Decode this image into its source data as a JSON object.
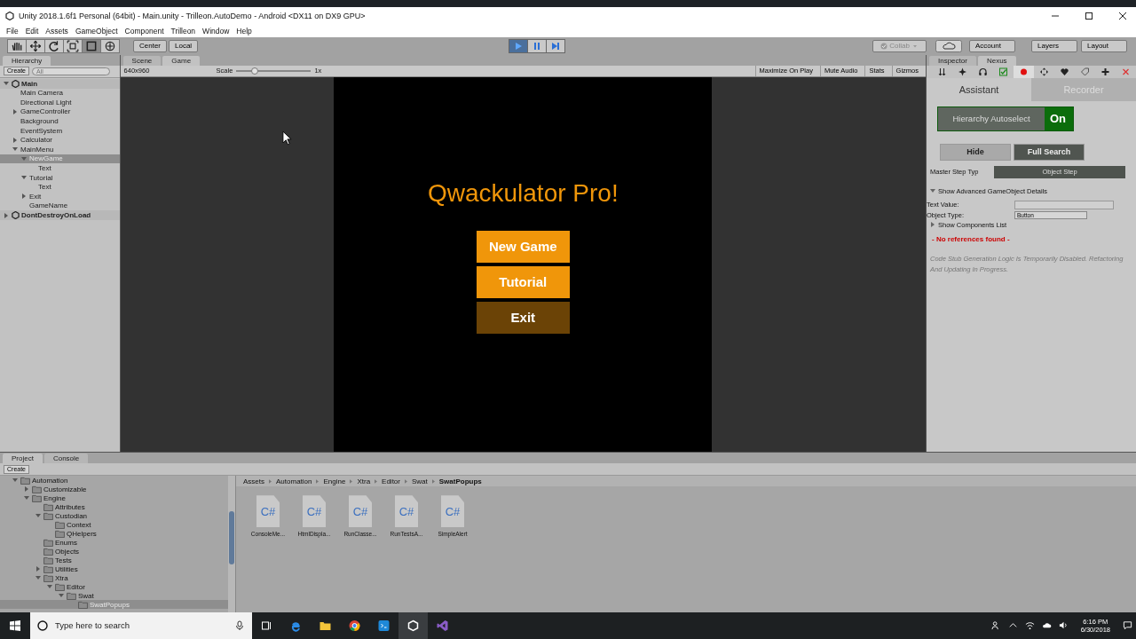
{
  "window": {
    "title": "Unity 2018.1.6f1 Personal (64bit) - Main.unity - Trilleon.AutoDemo - Android <DX11 on DX9 GPU>"
  },
  "menu": [
    "File",
    "Edit",
    "Assets",
    "GameObject",
    "Component",
    "Trilleon",
    "Window",
    "Help"
  ],
  "toolbar": {
    "pivot": "Center",
    "space": "Local",
    "play": [
      {
        "kind": "play",
        "on": true
      },
      {
        "kind": "pause",
        "on": false
      },
      {
        "kind": "step",
        "on": false
      }
    ],
    "collab": "Collab",
    "account": "Account",
    "layers": "Layers",
    "layout": "Layout"
  },
  "hierarchy": {
    "tab": "Hierarchy",
    "create": "Create",
    "search_placeholder": "All",
    "items": [
      {
        "label": "Main",
        "kind": "scene",
        "expanded": true,
        "selected": false,
        "children": [
          {
            "label": "Main Camera",
            "selected": false
          },
          {
            "label": "Directional Light",
            "selected": false
          },
          {
            "label": "GameController",
            "expanded": false,
            "selected": false
          },
          {
            "label": "Background",
            "selected": false
          },
          {
            "label": "EventSystem",
            "selected": false
          },
          {
            "label": "Calculator",
            "expanded": false,
            "selected": false
          },
          {
            "label": "MainMenu",
            "expanded": true,
            "selected": false,
            "children": [
              {
                "label": "NewGame",
                "expanded": true,
                "selected": true,
                "children": [
                  {
                    "label": "Text",
                    "selected": false
                  }
                ]
              },
              {
                "label": "Tutorial",
                "expanded": true,
                "selected": false,
                "children": [
                  {
                    "label": "Text",
                    "selected": false
                  }
                ]
              },
              {
                "label": "Exit",
                "expanded": false,
                "selected": false
              },
              {
                "label": "GameName",
                "selected": false
              }
            ]
          }
        ]
      },
      {
        "label": "DontDestroyOnLoad",
        "kind": "scene",
        "expanded": false,
        "selected": false
      }
    ]
  },
  "game": {
    "tabs": [
      {
        "label": "Scene",
        "selected": false
      },
      {
        "label": "Game",
        "selected": true
      }
    ],
    "resolution": "640x960",
    "scale_label": "Scale",
    "scale": {
      "level": 0.25
    },
    "scale_value": "1x",
    "options": [
      "Maximize On Play",
      "Mute Audio",
      "Stats",
      "Gizmos"
    ],
    "title": "Qwackulator Pro!",
    "buttons": [
      {
        "label": "New Game",
        "color": "#f0960a"
      },
      {
        "label": "Tutorial",
        "color": "#f0960a"
      },
      {
        "label": "Exit",
        "color": "#6b4306"
      }
    ]
  },
  "inspector": {
    "tabs": [
      {
        "label": "Inspector",
        "selected": false
      },
      {
        "label": "Nexus",
        "selected": true
      }
    ],
    "modes": [
      {
        "label": "Assistant",
        "selected": true
      },
      {
        "label": "Recorder",
        "selected": false
      }
    ],
    "autoselect": {
      "label": "Hierarchy Autoselect",
      "on": true,
      "state": "On"
    },
    "search_modes": [
      {
        "label": "Hide",
        "selected": false
      },
      {
        "label": "Full Search",
        "selected": true
      }
    ],
    "step_type_label": "Master Step Typ",
    "step_type": "Object Step",
    "advanced": {
      "label": "Show Advanced GameObject Details",
      "expanded": true
    },
    "text_value_label": "Text Value:",
    "object_type_label": "Object Type:",
    "object_type": "Button",
    "components": {
      "label": "Show Components List",
      "expanded": false
    },
    "error": "- No references found -",
    "note": "Code Stub Generation Logic Is Temporarily Disabled. Refactoring And Updating In Progress."
  },
  "project": {
    "tabs": [
      {
        "label": "Project",
        "selected": true
      },
      {
        "label": "Console",
        "selected": false
      }
    ],
    "create": "Create",
    "items": [
      {
        "label": "Automation",
        "expanded": true,
        "selected": false,
        "children": [
          {
            "label": "Customizable",
            "expanded": false,
            "selected": false
          },
          {
            "label": "Engine",
            "expanded": true,
            "selected": false,
            "children": [
              {
                "label": "Attributes",
                "selected": false
              },
              {
                "label": "Custodian",
                "expanded": true,
                "selected": false,
                "children": [
                  {
                    "label": "Context",
                    "selected": false
                  },
                  {
                    "label": "QHelpers",
                    "selected": false
                  }
                ]
              },
              {
                "label": "Enums",
                "selected": false
              },
              {
                "label": "Objects",
                "selected": false
              },
              {
                "label": "Tests",
                "selected": false
              },
              {
                "label": "Utilities",
                "expanded": false,
                "selected": false
              },
              {
                "label": "Xtra",
                "expanded": true,
                "selected": false,
                "children": [
                  {
                    "label": "Editor",
                    "expanded": true,
                    "selected": false,
                    "children": [
                      {
                        "label": "Swat",
                        "expanded": true,
                        "selected": false,
                        "children": [
                          {
                            "label": "SwatPopups",
                            "selected": true
                          }
                        ]
                      }
                    ]
                  }
                ]
              }
            ]
          }
        ]
      }
    ],
    "breadcrumb": [
      "Assets",
      "Automation",
      "Engine",
      "Xtra",
      "Editor",
      "Swat",
      "SwatPopups"
    ],
    "files": [
      {
        "label": "ConsoleMe...",
        "type": "C#"
      },
      {
        "label": "HtmlDispla...",
        "type": "C#"
      },
      {
        "label": "RunClasse...",
        "type": "C#"
      },
      {
        "label": "RunTestsA...",
        "type": "C#"
      },
      {
        "label": "SimpleAlert",
        "type": "C#"
      }
    ]
  },
  "taskbar": {
    "search_placeholder": "Type here to search",
    "time": "6:16 PM",
    "date": "6/30/2018"
  }
}
